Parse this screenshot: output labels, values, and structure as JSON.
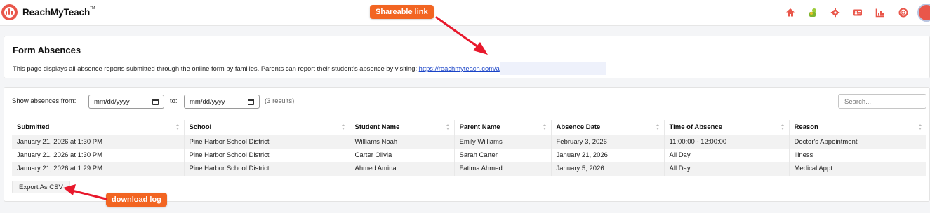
{
  "app": {
    "name": "ReachMyTeach",
    "trademark": "TM"
  },
  "nav": {
    "icons": [
      "home-icon",
      "students-icon",
      "settings-icon",
      "contact-card-icon",
      "reports-chart-icon",
      "help-lifebuoy-icon"
    ]
  },
  "page": {
    "title": "Form Absences",
    "description": "This page displays all absence reports submitted through the online form by families. Parents can report their student's absence by visiting:",
    "link": "https://reachmyteach.com/a"
  },
  "filters": {
    "from_label": "Show absences from:",
    "from_placeholder": "mm/dd/yyyy",
    "to_label": "to:",
    "to_placeholder": "mm/dd/yyyy",
    "results": "(3 results)",
    "search_placeholder": "Search..."
  },
  "table": {
    "columns": [
      "Submitted",
      "School",
      "Student Name",
      "Parent Name",
      "Absence Date",
      "Time of Absence",
      "Reason"
    ],
    "rows": [
      [
        "January 21, 2026 at 1:30 PM",
        "Pine Harbor School District",
        "Williams Noah",
        "Emily Williams",
        "February 3, 2026",
        "11:00:00 - 12:00:00",
        "Doctor's Appointment"
      ],
      [
        "January 21, 2026 at 1:30 PM",
        "Pine Harbor School District",
        "Carter Olivia",
        "Sarah Carter",
        "January 21, 2026",
        "All Day",
        "Illness"
      ],
      [
        "January 21, 2026 at 1:29 PM",
        "Pine Harbor School District",
        "Ahmed Amina",
        "Fatima Ahmed",
        "January 5, 2026",
        "All Day",
        "Medical Appt"
      ]
    ]
  },
  "export_label": "Export As CSV",
  "annotations": {
    "shareable_link": "Shareable link",
    "download_log": "download log"
  },
  "colors": {
    "brand_red": "#e9564a",
    "callout_orange": "#f26522",
    "arrow_red": "#e8182c",
    "link_blue": "#1a44c8"
  }
}
